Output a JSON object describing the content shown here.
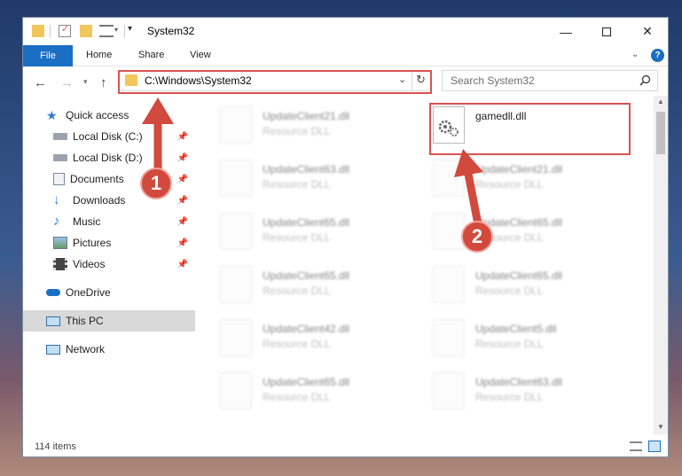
{
  "window": {
    "title": "System32"
  },
  "ribbon": {
    "tabs": [
      "File",
      "Home",
      "Share",
      "View"
    ]
  },
  "address": {
    "path": "C:\\Windows\\System32"
  },
  "search": {
    "placeholder": "Search System32"
  },
  "sidebar": {
    "items": [
      {
        "label": "Quick access",
        "icon": "star-icon"
      },
      {
        "label": "Local Disk (C:)",
        "icon": "drive-icon",
        "pinned": true
      },
      {
        "label": "Local Disk (D:)",
        "icon": "drive-icon",
        "pinned": true
      },
      {
        "label": "Documents",
        "icon": "documents-icon",
        "pinned": true
      },
      {
        "label": "Downloads",
        "icon": "download-icon",
        "pinned": true
      },
      {
        "label": "Music",
        "icon": "music-icon",
        "pinned": true
      },
      {
        "label": "Pictures",
        "icon": "pictures-icon",
        "pinned": true
      },
      {
        "label": "Videos",
        "icon": "videos-icon",
        "pinned": true
      },
      {
        "label": "OneDrive",
        "icon": "cloud-icon"
      },
      {
        "label": "This PC",
        "icon": "pc-icon",
        "selected": true
      },
      {
        "label": "Network",
        "icon": "network-icon"
      }
    ]
  },
  "files": {
    "highlighted": {
      "name": "gamedll.dll",
      "type": ""
    },
    "left_column": [
      {
        "name": "UpdateClient21.dll",
        "type": "Resource DLL"
      },
      {
        "name": "UpdateClient63.dll",
        "type": "Resource DLL"
      },
      {
        "name": "UpdateClient65.dll",
        "type": "Resource DLL"
      },
      {
        "name": "UpdateClient65.dll",
        "type": "Resource DLL"
      },
      {
        "name": "UpdateClient42.dll",
        "type": "Resource DLL"
      },
      {
        "name": "UpdateClient65.dll",
        "type": "Resource DLL"
      }
    ],
    "right_column": [
      {
        "name": "UpdateClient21.dll",
        "type": "Resource DLL"
      },
      {
        "name": "UpdateClient65.dll",
        "type": "Resource DLL"
      },
      {
        "name": "UpdateClient65.dll",
        "type": "Resource DLL"
      },
      {
        "name": "UpdateClient5.dll",
        "type": "Resource DLL"
      },
      {
        "name": "UpdateClient63.dll",
        "type": "Resource DLL"
      }
    ]
  },
  "status": {
    "item_count": "114 items"
  },
  "annotations": {
    "step1": "1",
    "step2": "2"
  },
  "colors": {
    "accent": "#1a6ec3",
    "annotation": "#d2493d",
    "selected_bg": "#cce4f7"
  }
}
